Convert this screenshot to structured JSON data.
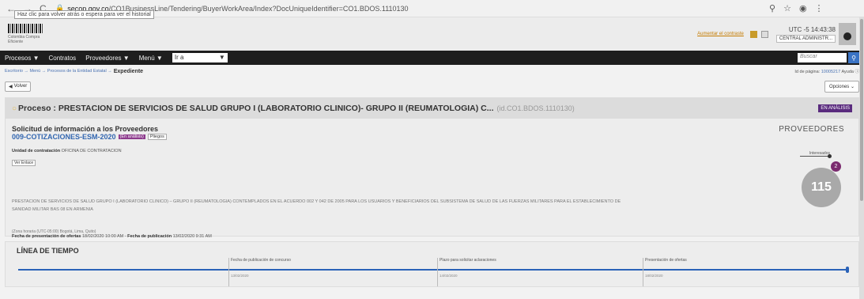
{
  "browser": {
    "back": "←",
    "forward": "→",
    "reload": "C",
    "url_host": "secop.gov.co",
    "url_path": "/CO1BusinessLine/Tendering/BuyerWorkArea/Index?DocUniqueIdentifier=CO1.BDOS.1110130",
    "tooltip": "Haz clic para volver atrás o espera para ver el historial"
  },
  "header": {
    "logo_text": "Colombia Compra Eficiente",
    "link_text": "Aumentar el contraste",
    "utc": "UTC -5 14:43:38",
    "entity": "CENTRAL ADMINISTR..."
  },
  "menu": {
    "items": [
      "Procesos ▼",
      "Contratos",
      "Proveedores ▼",
      "Menú ▼"
    ],
    "goto_label": "Ir a",
    "search_placeholder": "Buscar"
  },
  "breadcrumb": {
    "path": "Escritorio → Menú → Procesos de la Entidad Estatal →",
    "current": "Expediente",
    "page_id_label": "Id de página:",
    "page_id": "10005217",
    "help": "Ayuda"
  },
  "toolbar": {
    "volver": "Volver",
    "opciones": "Opciones"
  },
  "process": {
    "title": "Proceso : PRESTACION DE SERVICIOS DE SALUD GRUPO I (LABORATORIO CLINICO)- GRUPO II (REUMATOLOGIA) C...",
    "id": "(id.CO1.BDOS.1110130)",
    "status": "EN ANÁLISIS",
    "request_title": "Solicitud de información a los Proveedores",
    "code": "009-COTIZACIONES-ESM-2020",
    "chip_status": "(En análisis)",
    "chip_pliegos": "Pliegos",
    "unit_label": "Unidad de contratación",
    "unit_value": "OFICINA DE CONTRATACION",
    "ver_enlace": "Ver Enlace",
    "description": "PRESTACION DE SERVICIOS DE SALUD GRUPO I (LABORATORIO CLINICO) – GRUPO II (REUMATOLOGIA) CONTEMPLADOS EN EL ACUERDO 002 Y 042 DE 2005 PARA LOS USUARIOS Y BENEFICIARIOS DEL SUBSISTEMA DE SALUD DE LAS FUERZAS MILITARES PARA EL ESTABLECIMIENTO DE SANIDAD MILITAR BAS 08 EN ARMENIA",
    "timezone": "(Zona horaria (UTC-05:00) Bogotá, Lima, Quito)",
    "offer_label": "Fecha de presentación de ofertas",
    "offer_date": "18/02/2020 10:00 AM",
    "pub_label": "Fecha de publicación",
    "pub_date": "13/02/2020 9:31 AM"
  },
  "providers": {
    "title": "PROVEEDORES",
    "interested_label": "Interesados",
    "total": "115",
    "interested": "2"
  },
  "timeline": {
    "title": "LÍNEA DE TIEMPO",
    "events": [
      {
        "label": "Fecha de publicación de concurso",
        "date": "13/02/2020"
      },
      {
        "label": "Plazo para solicitar aclaraciones",
        "date": "14/02/2020"
      },
      {
        "label": "Presentación de ofertas",
        "date": "18/02/2020"
      }
    ]
  }
}
